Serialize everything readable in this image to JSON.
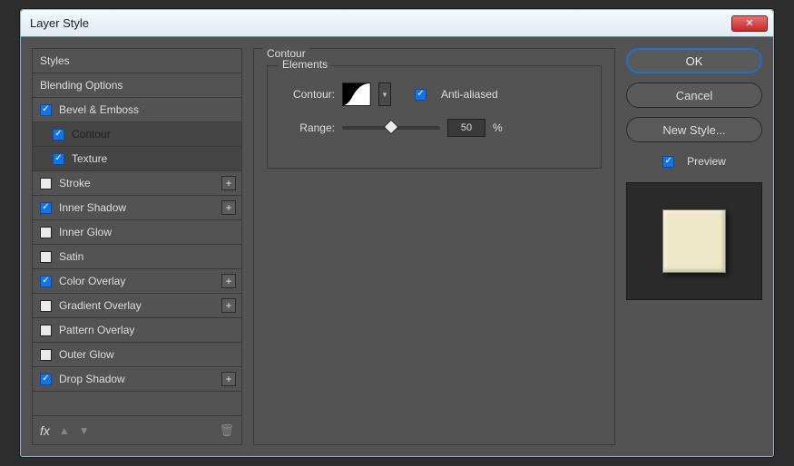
{
  "window": {
    "title": "Layer Style"
  },
  "sidebar": {
    "styles_label": "Styles",
    "blending_label": "Blending Options",
    "items": [
      {
        "label": "Bevel & Emboss",
        "checked": true,
        "plus": false,
        "indent": false,
        "selected": false
      },
      {
        "label": "Contour",
        "checked": true,
        "plus": false,
        "indent": true,
        "selected": true
      },
      {
        "label": "Texture",
        "checked": true,
        "plus": false,
        "indent": true,
        "selected": false
      },
      {
        "label": "Stroke",
        "checked": false,
        "plus": true,
        "indent": false,
        "selected": false
      },
      {
        "label": "Inner Shadow",
        "checked": true,
        "plus": true,
        "indent": false,
        "selected": false
      },
      {
        "label": "Inner Glow",
        "checked": false,
        "plus": false,
        "indent": false,
        "selected": false
      },
      {
        "label": "Satin",
        "checked": false,
        "plus": false,
        "indent": false,
        "selected": false
      },
      {
        "label": "Color Overlay",
        "checked": true,
        "plus": true,
        "indent": false,
        "selected": false
      },
      {
        "label": "Gradient Overlay",
        "checked": false,
        "plus": true,
        "indent": false,
        "selected": false
      },
      {
        "label": "Pattern Overlay",
        "checked": false,
        "plus": false,
        "indent": false,
        "selected": false
      },
      {
        "label": "Outer Glow",
        "checked": false,
        "plus": false,
        "indent": false,
        "selected": false
      },
      {
        "label": "Drop Shadow",
        "checked": true,
        "plus": true,
        "indent": false,
        "selected": false
      }
    ],
    "fx_label": "fx"
  },
  "panel": {
    "group_label": "Contour",
    "elements_label": "Elements",
    "contour_label": "Contour:",
    "antialiased_label": "Anti-aliased",
    "antialiased_checked": true,
    "range_label": "Range:",
    "range_value": "50",
    "range_pct": 50,
    "range_unit": "%"
  },
  "buttons": {
    "ok": "OK",
    "cancel": "Cancel",
    "new_style": "New Style...",
    "preview_label": "Preview",
    "preview_checked": true
  }
}
